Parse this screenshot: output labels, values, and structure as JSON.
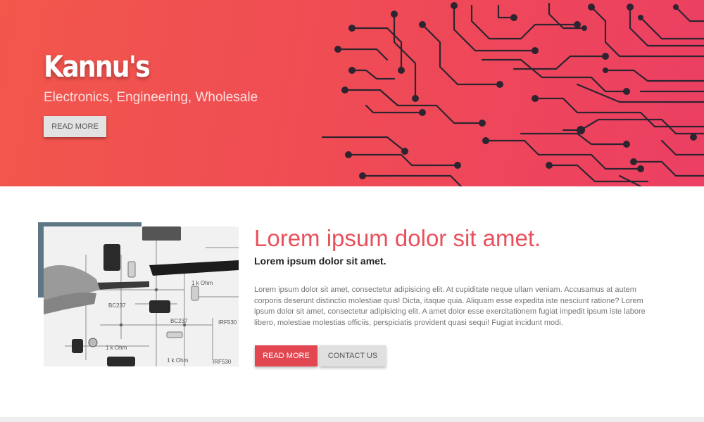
{
  "hero": {
    "title": "Kannu's",
    "subtitle": "Electronics, Engineering, Wholesale",
    "button_label": "READ MORE"
  },
  "content": {
    "title": "Lorem ipsum dolor sit amet.",
    "subtitle": "Lorem ipsum dolor sit amet.",
    "body": "Lorem ipsum dolor sit amet, consectetur adipisicing elit. At cupiditate neque ullam veniam. Accusamus at autem corporis deserunt distinctio molestiae quis! Dicta, itaque quia. Aliquam esse expedita iste nesciunt ratione? Lorem ipsum dolor sit amet, consectetur adipisicing elit. A amet dolor esse exercitationem fugiat impedit ipsum iste labore libero, molestiae molestias officiis, perspiciatis provident quasi sequi! Fugiat incidunt modi.",
    "primary_button": "READ MORE",
    "secondary_button": "CONTACT US"
  },
  "photo_labels": [
    "BC237",
    "1 k Ohm",
    "IRF530",
    "BC237",
    "1 k Ohm",
    "IRF530",
    "1 k Ohm"
  ],
  "colors": {
    "hero_gradient_start": "#f2574b",
    "hero_gradient_end": "#ec3f63",
    "accent": "#e24651",
    "title_color": "#e8505b",
    "slate": "#5f7785"
  }
}
